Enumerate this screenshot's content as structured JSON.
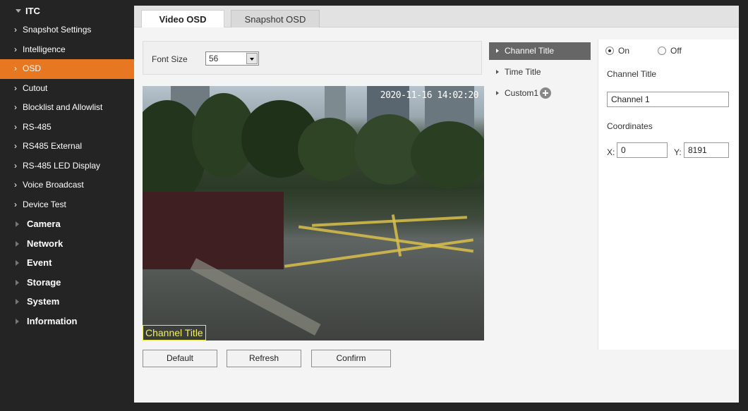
{
  "sidebar": {
    "group": "ITC",
    "items": [
      {
        "label": "Snapshot Settings",
        "active": false
      },
      {
        "label": "Intelligence",
        "active": false
      },
      {
        "label": "OSD",
        "active": true
      },
      {
        "label": "Cutout",
        "active": false
      },
      {
        "label": "Blocklist and Allowlist",
        "active": false
      },
      {
        "label": "RS-485",
        "active": false
      },
      {
        "label": "RS485 External",
        "active": false
      },
      {
        "label": "RS-485 LED Display",
        "active": false
      },
      {
        "label": "Voice Broadcast",
        "active": false
      },
      {
        "label": "Device Test",
        "active": false
      }
    ],
    "sections": [
      "Camera",
      "Network",
      "Event",
      "Storage",
      "System",
      "Information"
    ]
  },
  "tabs": {
    "video": "Video OSD",
    "snapshot": "Snapshot OSD"
  },
  "font": {
    "label": "Font Size",
    "value": "56"
  },
  "video": {
    "timestamp": "2020-11-16 14:02:20",
    "title_overlay": "Channel Title"
  },
  "buttons": {
    "default": "Default",
    "refresh": "Refresh",
    "confirm": "Confirm"
  },
  "osd_list": {
    "channel": "Channel Title",
    "time": "Time Title",
    "custom": "Custom1"
  },
  "props": {
    "on": "On",
    "off": "Off",
    "selected": "On",
    "title_label": "Channel Title",
    "title_value": "Channel 1",
    "coords_label": "Coordinates",
    "x_label": "X:",
    "x_value": "0",
    "y_label": "Y:",
    "y_value": "8191"
  },
  "colors": {
    "accent": "#e87722",
    "sidebar": "#242424"
  }
}
